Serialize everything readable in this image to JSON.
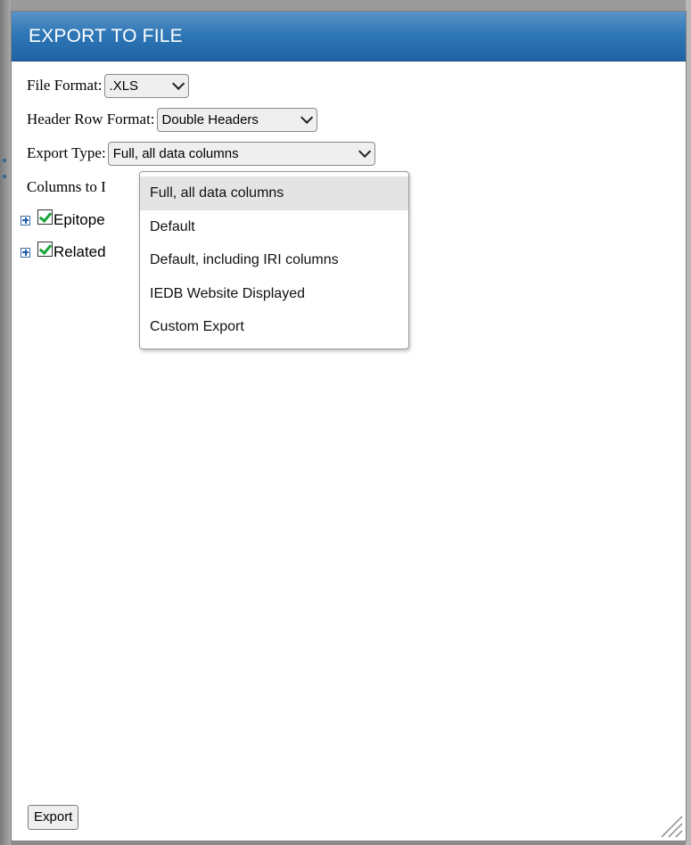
{
  "dialog": {
    "title": "EXPORT TO FILE"
  },
  "form": {
    "file_format": {
      "label": "File Format:",
      "value": ".XLS"
    },
    "header_row_format": {
      "label": "Header Row Format:",
      "value": "Double Headers"
    },
    "export_type": {
      "label": "Export Type:",
      "value": "Full, all data columns"
    },
    "columns_label": "Columns to I"
  },
  "export_type_options": [
    "Full, all data columns",
    "Default",
    "Default, including IRI columns",
    "IEDB Website Displayed",
    "Custom Export"
  ],
  "tree": {
    "items": [
      {
        "label": "Epitope",
        "checked": true
      },
      {
        "label": "Related",
        "checked": true
      }
    ]
  },
  "footer": {
    "export_label": "Export"
  },
  "colors": {
    "titlebar": "#2f77b6",
    "checkmark": "#1aa33a",
    "selected_option_bg": "#e4e4e4"
  }
}
